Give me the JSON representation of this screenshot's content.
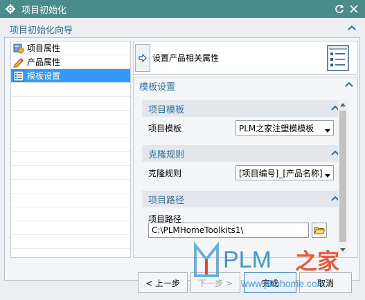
{
  "window": {
    "title": "项目初始化",
    "colors": {
      "titlebar": "#4a8b8b",
      "accent": "#2d6f9a",
      "selection": "#3399ff"
    }
  },
  "wizard": {
    "header": "项目初始化向导"
  },
  "tree": {
    "items": [
      {
        "label": "项目属性",
        "icon": "project-attrs-icon",
        "selected": false
      },
      {
        "label": "产品属性",
        "icon": "pencil-icon",
        "selected": false
      },
      {
        "label": "模板设置",
        "icon": "list-icon",
        "selected": true
      }
    ]
  },
  "step": {
    "label": "设置产品相关属性"
  },
  "template_settings": {
    "header": "模板设置",
    "project_template": {
      "header": "项目模板",
      "label": "项目模板",
      "value": "PLM之家注塑模模板"
    },
    "clone_rule": {
      "header": "克隆规则",
      "label": "克隆规则",
      "value": "[项目编号]_[产品名称]"
    },
    "project_path": {
      "header": "项目路径",
      "label": "项目路径",
      "value": "C:\\PLMHomeToolkits1\\"
    }
  },
  "buttons": {
    "prev": "< 上一步",
    "next": "下一步 >",
    "finish": "完成",
    "cancel": "取消"
  },
  "watermark": {
    "brand": "PLM",
    "brand_cn": "之家",
    "url": "www.plmhome.com"
  }
}
